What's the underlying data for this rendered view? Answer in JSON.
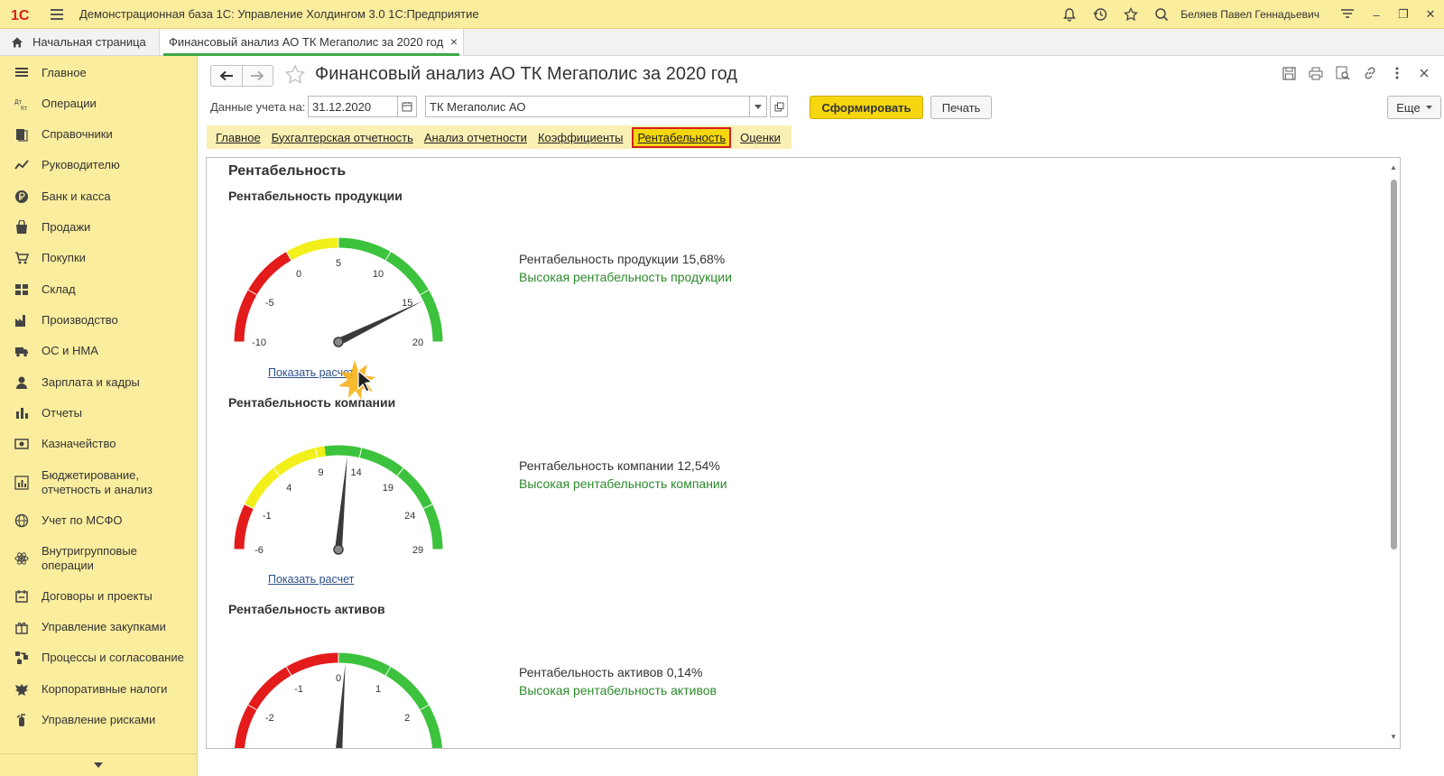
{
  "app": {
    "title": "Демонстрационная база 1С: Управление Холдингом 3.0 1С:Предприятие",
    "user": "Беляев Павел Геннадьевич",
    "logo": "1С"
  },
  "tabs": {
    "home_label": "Начальная страница",
    "active_label": "Финансовый анализ АО ТК Мегаполис за 2020 год",
    "close_glyph": "×"
  },
  "sidebar": {
    "items": [
      {
        "label": "Главное",
        "icon": "menu-icon"
      },
      {
        "label": "Операции",
        "icon": "dt-kt-icon"
      },
      {
        "label": "Справочники",
        "icon": "books-icon"
      },
      {
        "label": "Руководителю",
        "icon": "trend-icon"
      },
      {
        "label": "Банк и касса",
        "icon": "ruble-icon"
      },
      {
        "label": "Продажи",
        "icon": "bag-icon"
      },
      {
        "label": "Покупки",
        "icon": "cart-icon"
      },
      {
        "label": "Склад",
        "icon": "grid-icon"
      },
      {
        "label": "Производство",
        "icon": "factory-icon"
      },
      {
        "label": "ОС и НМА",
        "icon": "truck-icon"
      },
      {
        "label": "Зарплата и кадры",
        "icon": "person-icon"
      },
      {
        "label": "Отчеты",
        "icon": "bars-icon"
      },
      {
        "label": "Казначейство",
        "icon": "treasury-icon"
      },
      {
        "label": "Бюджетирование,\nотчетность и анализ",
        "icon": "budget-icon"
      },
      {
        "label": "Учет по МСФО",
        "icon": "globe-icon"
      },
      {
        "label": "Внутригрупповые\nоперации",
        "icon": "atom-icon"
      },
      {
        "label": "Договоры и проекты",
        "icon": "contract-icon"
      },
      {
        "label": "Управление закупками",
        "icon": "gift-icon"
      },
      {
        "label": "Процессы и согласование",
        "icon": "process-icon"
      },
      {
        "label": "Корпоративные налоги",
        "icon": "eagle-icon"
      },
      {
        "label": "Управление рисками",
        "icon": "extinguisher-icon"
      }
    ]
  },
  "document": {
    "title": "Финансовый анализ АО ТК Мегаполис за 2020 год",
    "date_label": "Данные учета на:",
    "date_value": "31.12.2020",
    "org_value": "ТК Мегаполис АО",
    "btn_generate": "Сформировать",
    "btn_print": "Печать",
    "btn_more": "Еще"
  },
  "section_tabs": [
    {
      "label": "Главное",
      "active": false
    },
    {
      "label": "Бухгалтерская отчетность",
      "active": false
    },
    {
      "label": "Анализ отчетности",
      "active": false
    },
    {
      "label": "Коэффициенты",
      "active": false
    },
    {
      "label": "Рентабельность",
      "active": true
    },
    {
      "label": "Оценки",
      "active": false
    }
  ],
  "content": {
    "heading": "Рентабельность",
    "gauges": [
      {
        "title": "Рентабельность продукции",
        "value_text": "Рентабельность продукции 15,68%",
        "note": "Высокая рентабельность продукции",
        "link": "Показать расчет",
        "value": 15.68,
        "ticks": [
          "-10",
          "-5",
          "0",
          "5",
          "10",
          "15",
          "20"
        ],
        "range": [
          -10,
          20
        ],
        "zones": [
          {
            "to": 0,
            "color": "#e31b1b"
          },
          {
            "to": 5,
            "color": "#f2ef1a"
          },
          {
            "to": 20,
            "color": "#3cc23c"
          }
        ]
      },
      {
        "title": "Рентабельность компании",
        "value_text": "Рентабельность компании 12,54%",
        "note": "Высокая рентабельность компании",
        "link": "Показать расчет",
        "value": 12.54,
        "ticks": [
          "-6",
          "-1",
          "4",
          "9",
          "14",
          "19",
          "24",
          "29"
        ],
        "range": [
          -6,
          29
        ],
        "zones": [
          {
            "to": -1,
            "color": "#e31b1b"
          },
          {
            "to": 10,
            "color": "#f2ef1a"
          },
          {
            "to": 29,
            "color": "#3cc23c"
          }
        ]
      },
      {
        "title": "Рентабельность активов",
        "value_text": "Рентабельность активов 0,14%",
        "note": "Высокая рентабельность активов",
        "link": "",
        "value": 0.14,
        "ticks": [
          "-2",
          "-1",
          "0",
          "1",
          "2"
        ],
        "range": [
          -3,
          3
        ],
        "zones": [
          {
            "to": 0,
            "color": "#e31b1b"
          },
          {
            "to": 3,
            "color": "#3cc23c"
          }
        ]
      }
    ]
  }
}
